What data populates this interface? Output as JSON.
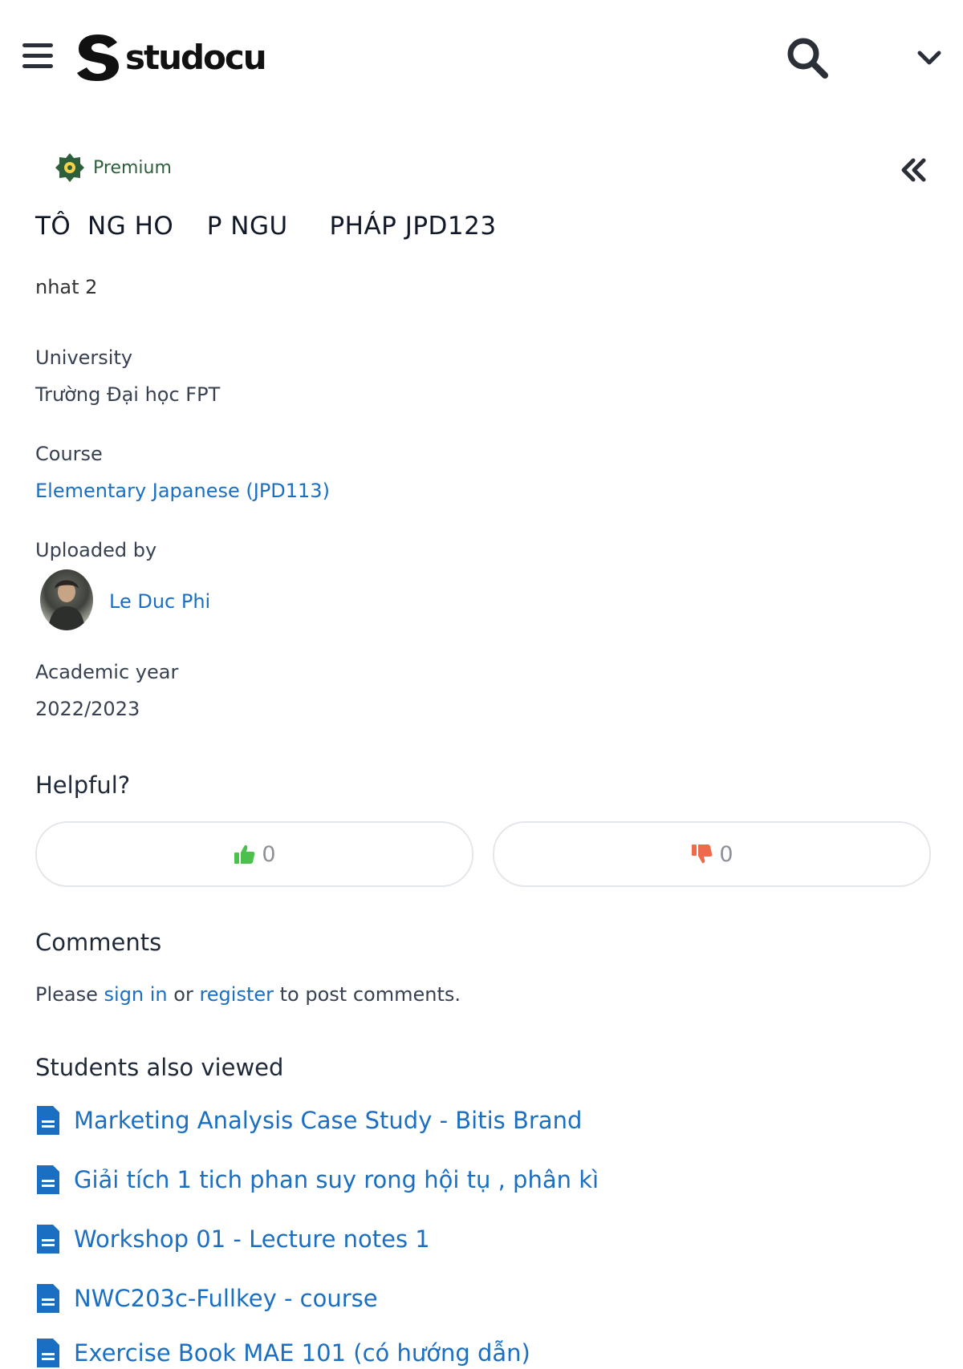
{
  "header": {
    "logo_text": "studocu",
    "menu_icon": "hamburger-menu-icon",
    "search_icon": "search-icon",
    "dropdown_icon": "chevron-down-icon"
  },
  "document": {
    "badge": "Premium",
    "title": "TÔ  NG HO    P NGU     PHÁP JPD123",
    "subtitle": "nhat 2",
    "university_label": "University",
    "university": "Trường Đại học FPT",
    "course_label": "Course",
    "course": "Elementary Japanese (JPD113)",
    "uploaded_label": "Uploaded by",
    "uploader": "Le Duc Phi",
    "year_label": "Academic year",
    "year": "2022/2023"
  },
  "helpful": {
    "title": "Helpful?",
    "likes": "0",
    "dislikes": "0"
  },
  "comments": {
    "title": "Comments",
    "prefix": "Please ",
    "sign_in": "sign in",
    "middle": " or ",
    "register": "register",
    "suffix": " to post comments."
  },
  "also_viewed": {
    "title": "Students also viewed",
    "items": [
      "Marketing Analysis Case Study - Bitis Brand",
      "Giải tích 1 tich phan suy rong hội tụ , phân kì",
      "Workshop 01 - Lecture notes 1",
      "NWC203c-Fullkey - course",
      "Exercise Book MAE 101 (có hướng dẫn)"
    ]
  },
  "colors": {
    "link": "#1b6fc2",
    "like": "#4cc04a",
    "dislike": "#ef6a4d",
    "premium": "#2d5f3a"
  }
}
